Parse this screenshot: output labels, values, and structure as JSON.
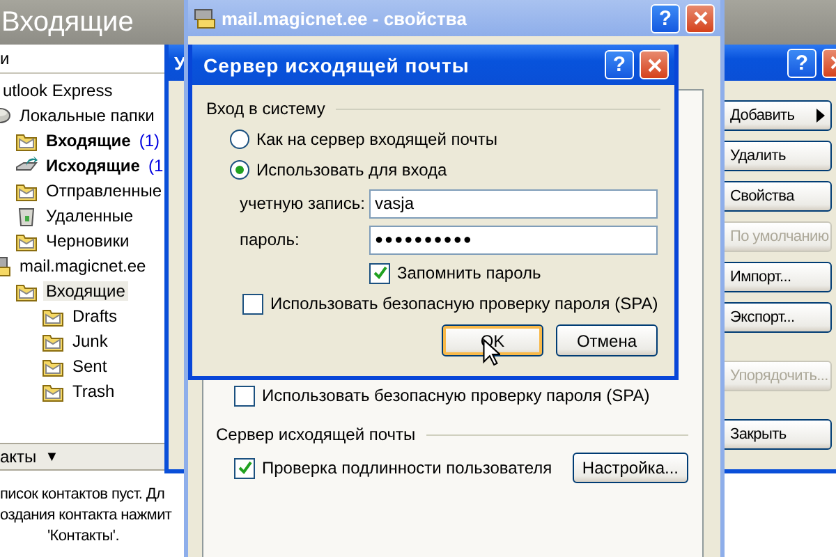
{
  "main_window": {
    "title": "Входящие",
    "folder_pane_header": "и",
    "folders": [
      {
        "name": "utlook Express",
        "unread": false,
        "selected": false,
        "children": [
          {
            "name": "Локальные папки",
            "kind": "local",
            "unread": false,
            "selected": false,
            "children": [
              {
                "name": "Входящие",
                "kind": "folder",
                "unread": true,
                "count": "(1)",
                "selected": false
              },
              {
                "name": "Исходящие",
                "kind": "outbox",
                "unread": true,
                "count": "(1",
                "selected": false
              },
              {
                "name": "Отправленные",
                "kind": "folder",
                "unread": false,
                "selected": false
              },
              {
                "name": "Удаленные",
                "kind": "trash",
                "unread": false,
                "selected": false
              },
              {
                "name": "Черновики",
                "kind": "folder",
                "unread": false,
                "selected": false
              }
            ]
          },
          {
            "name": "mail.magicnet.ee",
            "kind": "account",
            "unread": false,
            "selected": false,
            "children": [
              {
                "name": "Входящие",
                "kind": "folder",
                "unread": false,
                "selected": true,
                "children": [
                  {
                    "name": "Drafts",
                    "kind": "folder",
                    "unread": false,
                    "selected": false
                  },
                  {
                    "name": "Junk",
                    "kind": "folder",
                    "unread": false,
                    "selected": false
                  },
                  {
                    "name": "Sent",
                    "kind": "folder",
                    "unread": false,
                    "selected": false
                  },
                  {
                    "name": "Trash",
                    "kind": "folder",
                    "unread": false,
                    "selected": false
                  }
                ]
              }
            ]
          }
        ]
      }
    ],
    "contacts": {
      "header": "акты",
      "caret": "▼",
      "lines": [
        "писок контактов пуст. Дл",
        "оздания контакта нажмит",
        "'Контакты'."
      ]
    }
  },
  "accounts_window": {
    "title": "У",
    "active": true,
    "help": "?",
    "button_groups": [
      [
        {
          "label": "Добавить",
          "menu": true,
          "disabled": false
        },
        {
          "label": "Удалить",
          "menu": false,
          "disabled": false
        },
        {
          "label": "Свойства",
          "menu": false,
          "disabled": false
        },
        {
          "label": "По умолчанию",
          "menu": false,
          "disabled": true
        },
        {
          "label": "Импорт...",
          "menu": false,
          "disabled": false
        },
        {
          "label": "Экспорт...",
          "menu": false,
          "disabled": false
        }
      ],
      [
        {
          "label": "Упорядочить...",
          "menu": false,
          "disabled": true
        }
      ],
      [
        {
          "label": "Закрыть",
          "menu": false,
          "disabled": false
        }
      ]
    ]
  },
  "properties_window": {
    "title": "mail.magicnet.ee - свойства",
    "active": false,
    "help": "?",
    "spa_checkbox": {
      "label": "Использовать безопасную проверку пароля (SPA)",
      "checked": false
    },
    "outgoing_section": "Сервер исходящей почты",
    "auth_checkbox": {
      "label": "Проверка подлинности пользователя",
      "checked": true
    },
    "settings_button": "Настройка..."
  },
  "outgoing_dialog": {
    "title": "Сервер исходящей почты",
    "active": true,
    "help": "?",
    "group_label": "Вход в систему",
    "radios": [
      {
        "label": "Как на сервер входящей почты",
        "selected": false
      },
      {
        "label": "Использовать для входа",
        "selected": true
      }
    ],
    "account_label": "учетную запись:",
    "account_value": "vasja",
    "password_label": "пароль:",
    "password_value": "●●●●●●●●●●",
    "remember_checkbox": {
      "label": "Запомнить пароль",
      "checked": true
    },
    "spa_checkbox": {
      "label": "Использовать безопасную проверку пароля (SPA)",
      "checked": false
    },
    "buttons": [
      {
        "label": "OK",
        "default": true
      },
      {
        "label": "Отмена",
        "default": false
      }
    ]
  }
}
